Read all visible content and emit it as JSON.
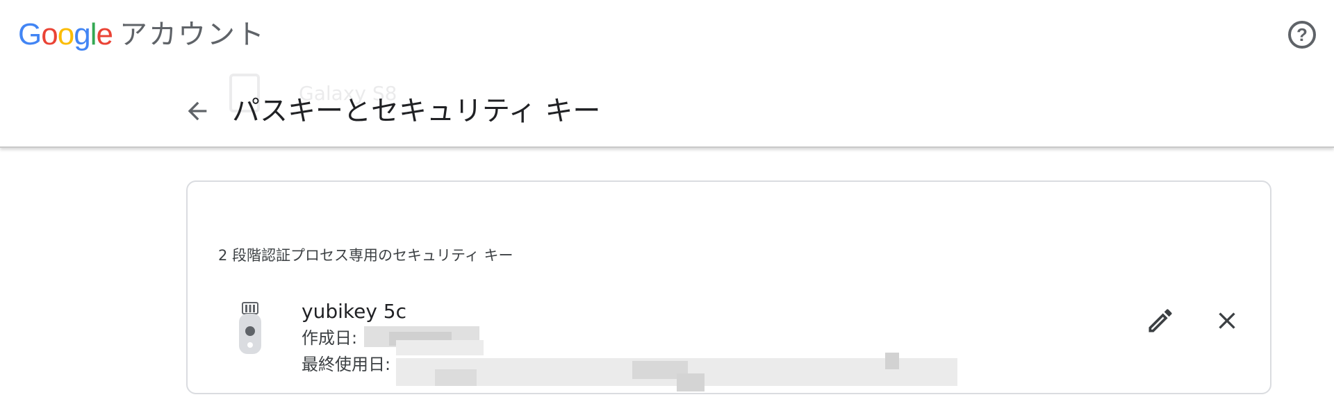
{
  "topbar": {
    "logo_letters": [
      {
        "char": "G",
        "color": "#4285F4"
      },
      {
        "char": "o",
        "color": "#EA4335"
      },
      {
        "char": "o",
        "color": "#FBBC05"
      },
      {
        "char": "g",
        "color": "#4285F4"
      },
      {
        "char": "l",
        "color": "#34A853"
      },
      {
        "char": "e",
        "color": "#EA4335"
      }
    ],
    "product_name": "アカウント",
    "help_icon": "help-circle-icon",
    "help_glyph": "?"
  },
  "header": {
    "back_icon": "arrow-back-icon",
    "title": "パスキーとセキュリティ キー",
    "ghost_item_text": "Galaxy S8"
  },
  "card": {
    "section_label": "2 段階認証プロセス専用のセキュリティ キー",
    "key": {
      "icon": "security-key-icon",
      "name": "yubikey 5c",
      "created_label": "作成日:",
      "last_used_label": "最終使用日:",
      "edit_icon": "pencil-icon",
      "remove_icon": "close-icon"
    }
  },
  "colors": {
    "icon_gray": "#5f6368",
    "border": "#dadce0",
    "text": "#202124"
  }
}
